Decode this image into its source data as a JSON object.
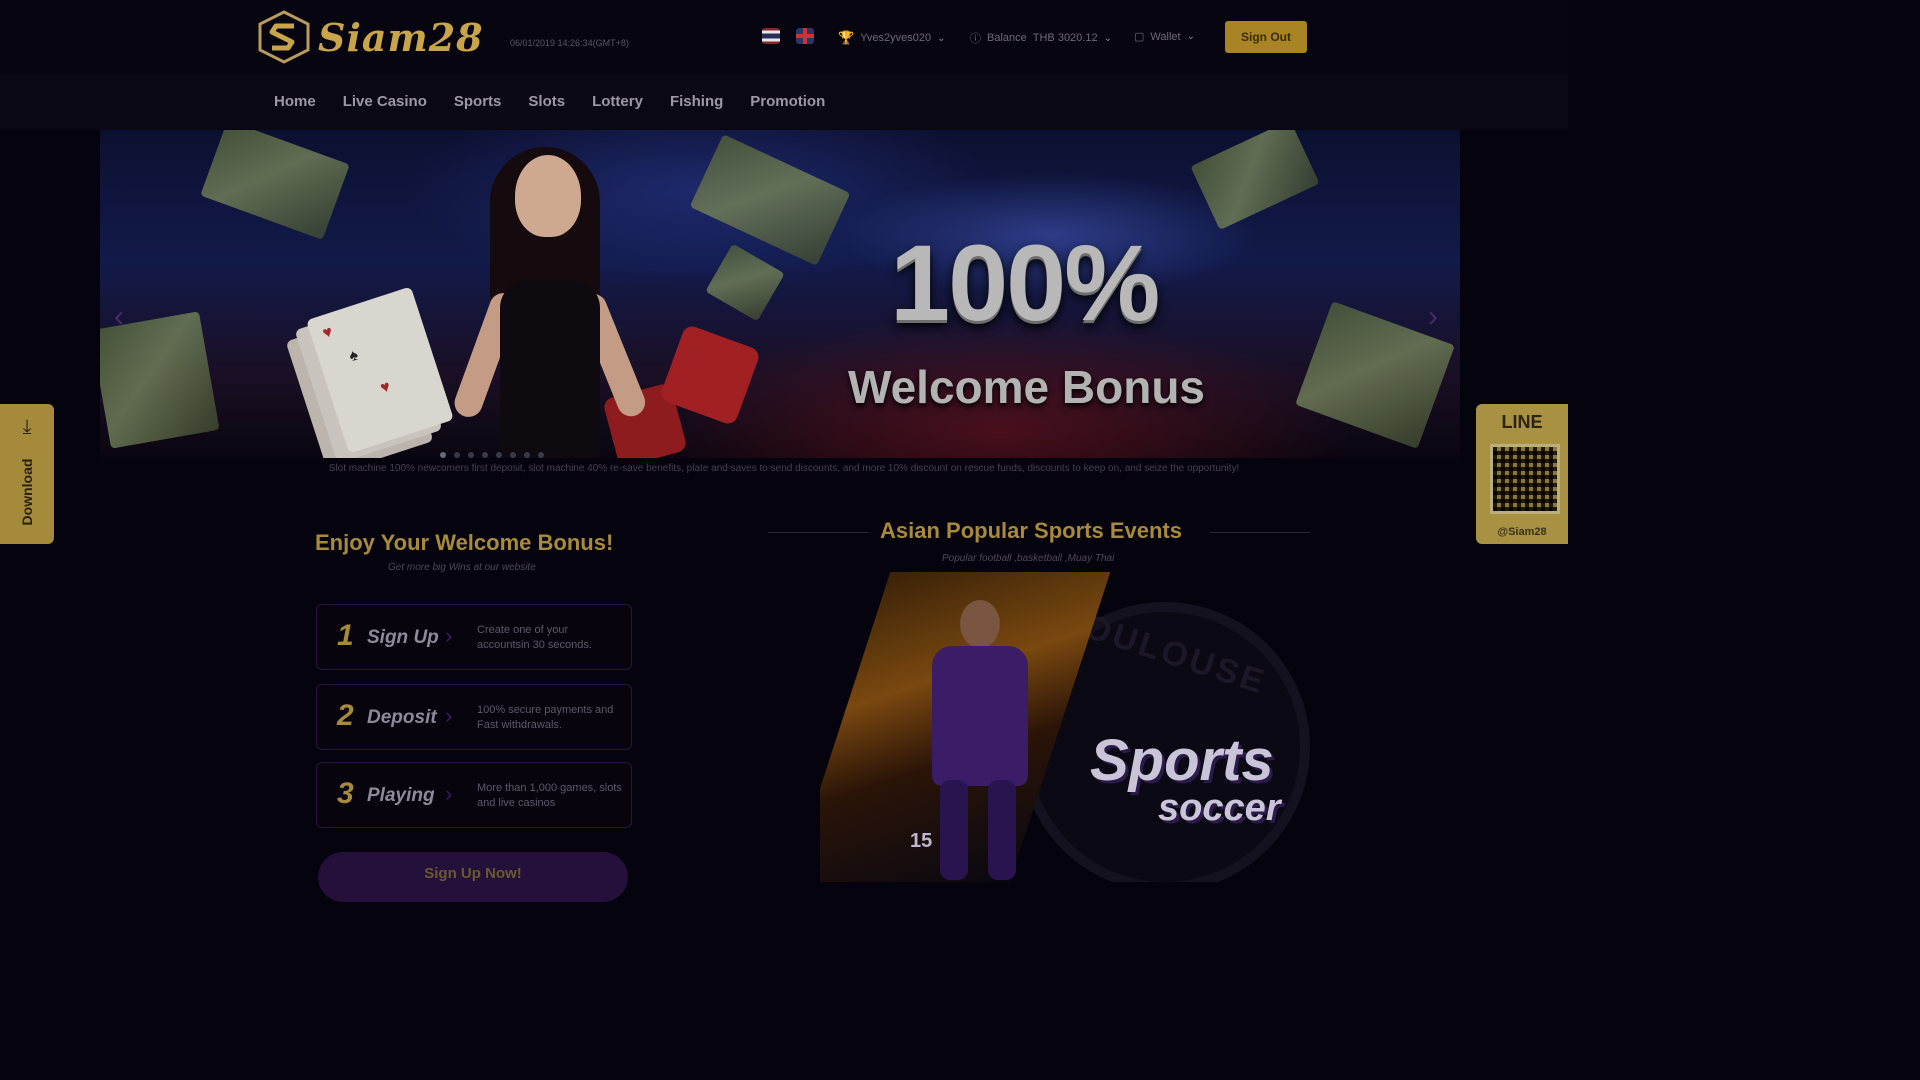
{
  "header": {
    "brand": "Siam28",
    "datetime": "06/01/2019 14:26:34(GMT+8)",
    "username": "Yves2yves020",
    "balance_label": "Balance",
    "balance_value": "THB 3020.12",
    "wallet_label": "Wallet",
    "sign_out_label": "Sign Out"
  },
  "nav": {
    "items": [
      "Home",
      "Live Casino",
      "Sports",
      "Slots",
      "Lottery",
      "Fishing",
      "Promotion"
    ]
  },
  "banner": {
    "headline_pct": "100%",
    "headline_text": "Welcome Bonus",
    "slides_total": 8,
    "slide_active": 1,
    "marquee": "Slot machine 100% newcomers first deposit, slot machine 40% re-save benefits, plate and saves to send discounts, and more 10% discount on rescue funds, discounts to keep on, and seize the opportunity!"
  },
  "side": {
    "download_label": "Download",
    "line_title": "LINE",
    "line_id": "@Siam28"
  },
  "welcome": {
    "title": "Enjoy Your Welcome Bonus!",
    "subtitle": "Get more big Wins at our website",
    "steps": [
      {
        "num": "1",
        "label": "Sign Up",
        "desc": "Create one of your accountsin 30 seconds."
      },
      {
        "num": "2",
        "label": "Deposit",
        "desc": "100% secure payments and Fast withdrawals."
      },
      {
        "num": "3",
        "label": "Playing",
        "desc": "More than 1,000 games, slots and live casinos"
      }
    ],
    "cta": "Sign Up Now!"
  },
  "sports": {
    "title": "Asian Popular Sports Events",
    "subtitle": "Popular football ,basketball ,Muay Thai",
    "banner_word1": "Sports",
    "banner_word2": "soccer",
    "crest_text": "TOULOUSE",
    "jersey_number": "15"
  },
  "colors": {
    "accent_gold": "#a88a3c",
    "background": "#05030d",
    "step_border": "#2c1440"
  }
}
